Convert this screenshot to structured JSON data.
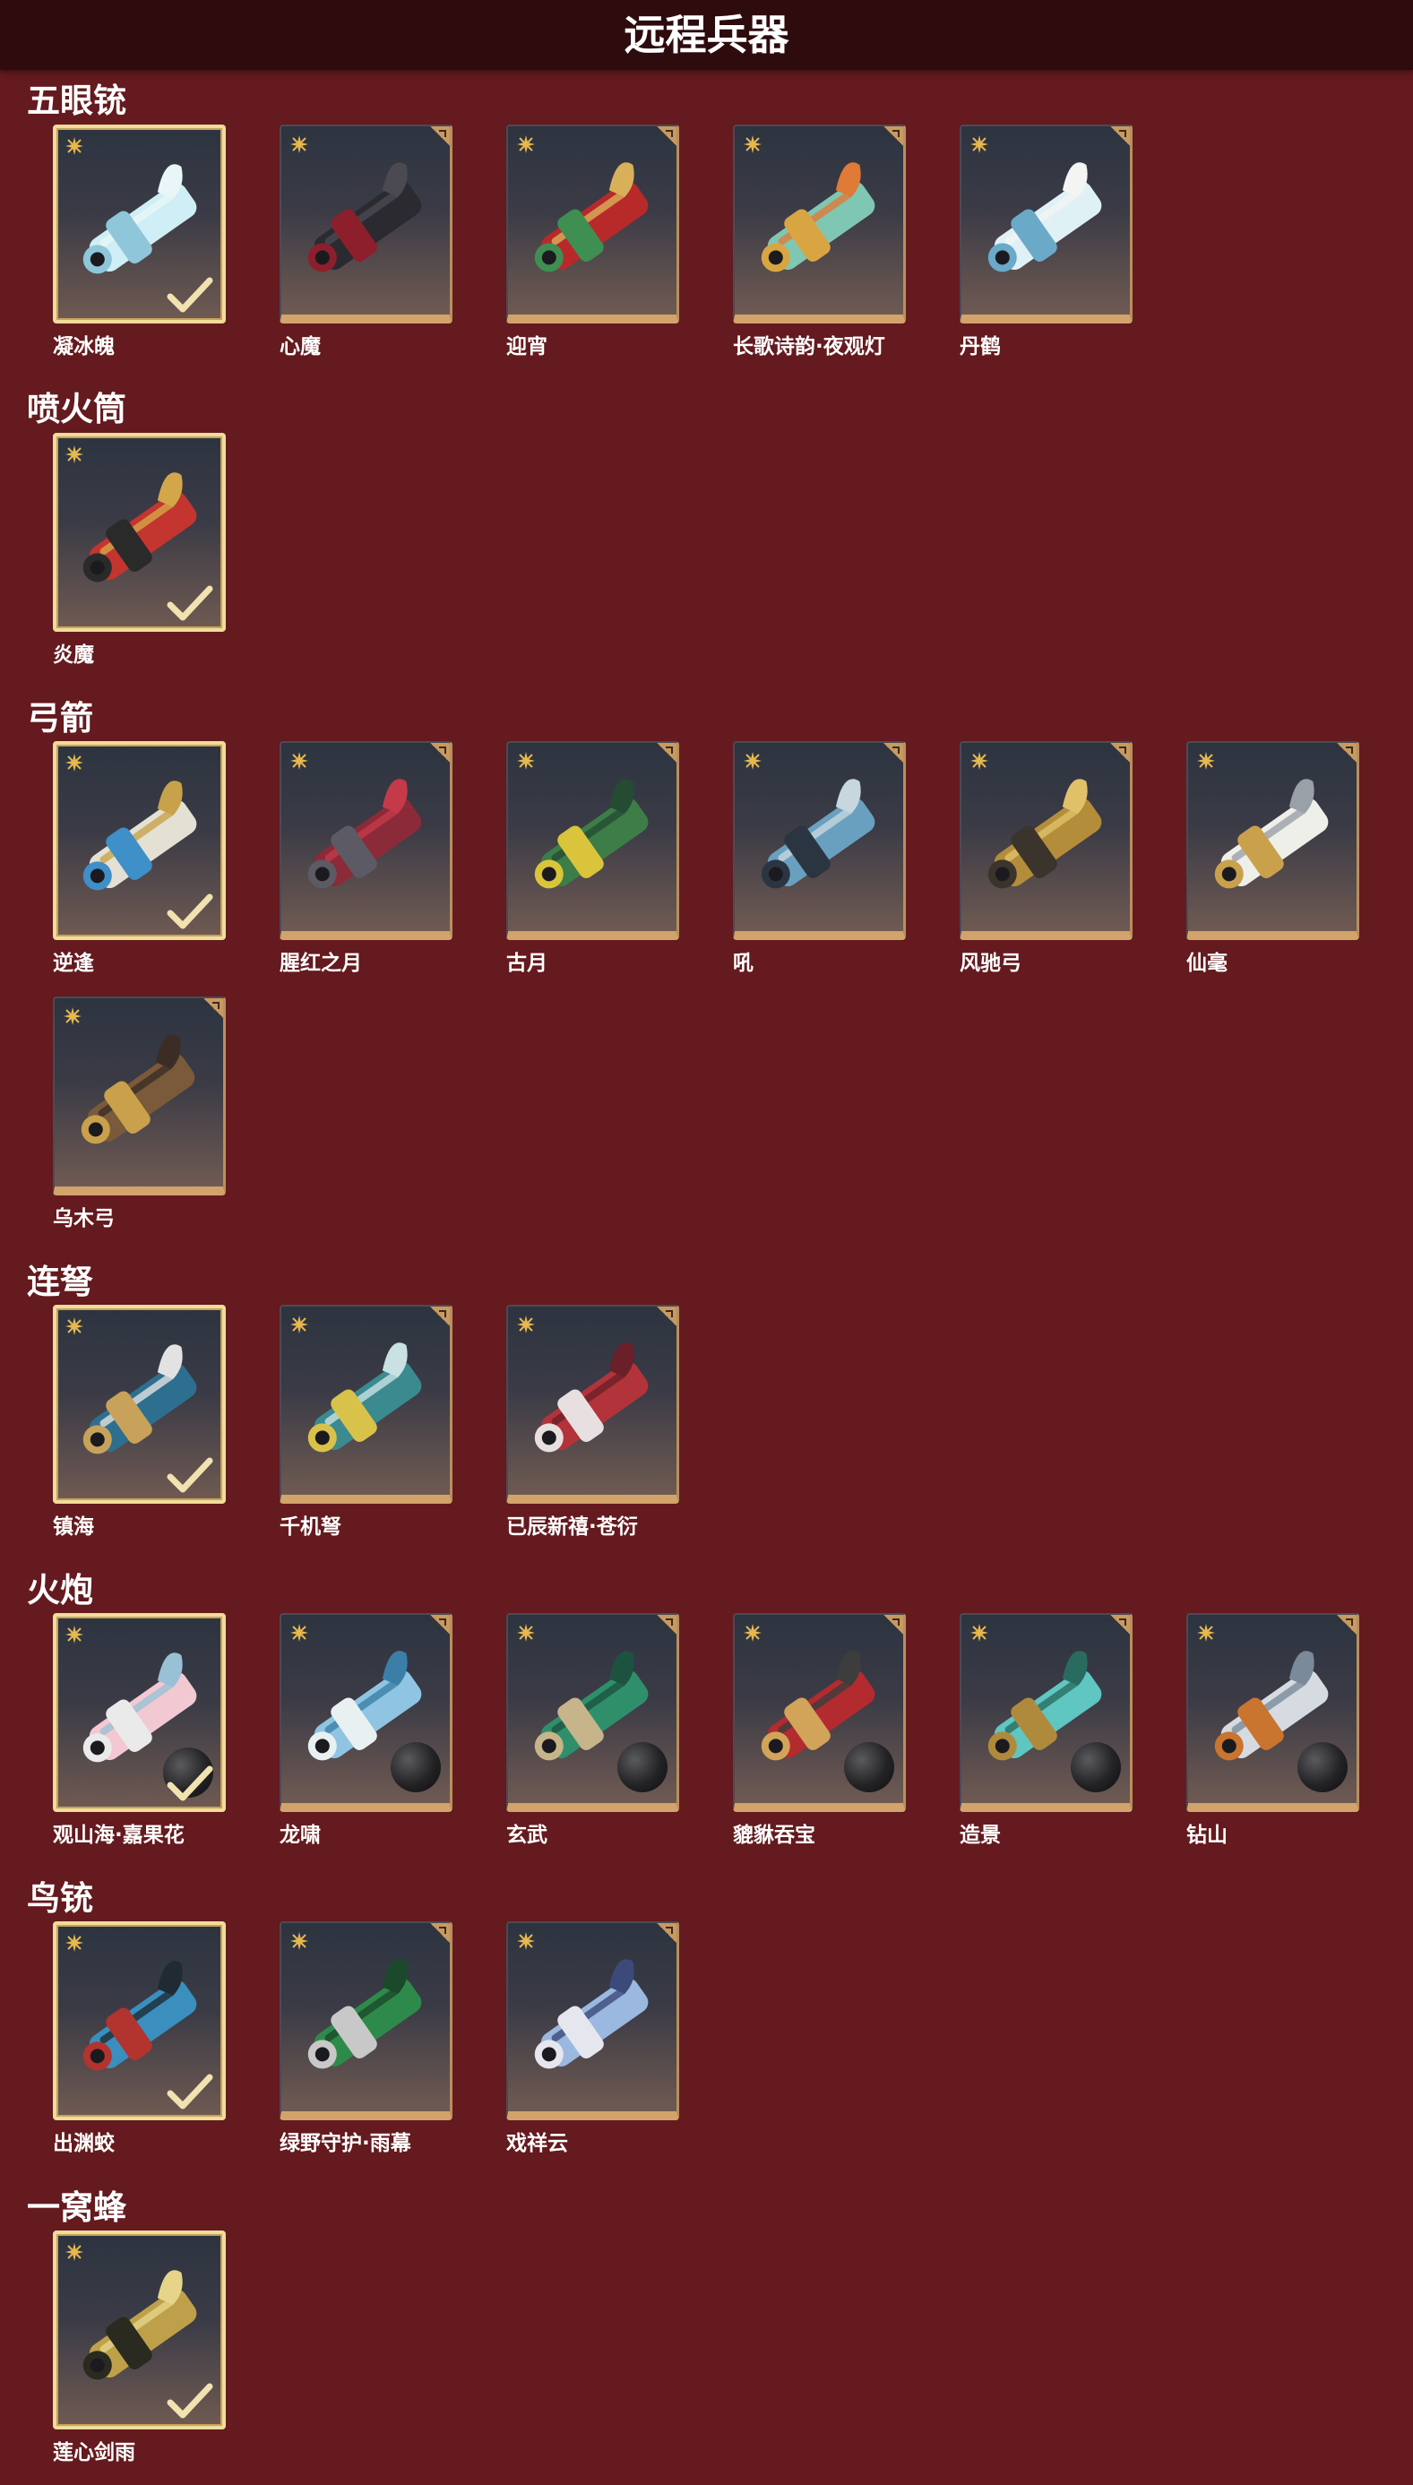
{
  "header": {
    "title": "远程兵器"
  },
  "colors": {
    "background": "#641a1e",
    "header_bar": "#2e0c0e",
    "card_border_gold": "#d2a36a",
    "selected_border": "#f1dc9a",
    "rarity_icon": "#e8b84d",
    "check": "#f2e2b0"
  },
  "sections": [
    {
      "title": "五眼铳",
      "items": [
        {
          "name": "凝冰魄",
          "selected": true,
          "art": "ice-cannon"
        },
        {
          "name": "心魔",
          "selected": false,
          "art": "demon-cannon"
        },
        {
          "name": "迎宵",
          "selected": false,
          "art": "red-cannon"
        },
        {
          "name": "长歌诗韵·夜观灯",
          "selected": false,
          "art": "jade-cannon"
        },
        {
          "name": "丹鹤",
          "selected": false,
          "art": "crane-cannon"
        }
      ]
    },
    {
      "title": "喷火筒",
      "items": [
        {
          "name": "炎魔",
          "selected": true,
          "art": "flame-tube"
        }
      ]
    },
    {
      "title": "弓箭",
      "items": [
        {
          "name": "逆逢",
          "selected": true,
          "art": "ornate-bow"
        },
        {
          "name": "腥红之月",
          "selected": false,
          "art": "crimson-bow"
        },
        {
          "name": "古月",
          "selected": false,
          "art": "green-bow"
        },
        {
          "name": "吼",
          "selected": false,
          "art": "blue-bow"
        },
        {
          "name": "风驰弓",
          "selected": false,
          "art": "gold-bow"
        },
        {
          "name": "仙毫",
          "selected": false,
          "art": "white-bow"
        },
        {
          "name": "乌木弓",
          "selected": false,
          "art": "wood-bow"
        }
      ]
    },
    {
      "title": "连弩",
      "items": [
        {
          "name": "镇海",
          "selected": true,
          "art": "sea-crossbow"
        },
        {
          "name": "千机弩",
          "selected": false,
          "art": "teal-crossbow"
        },
        {
          "name": "已辰新禧·苍衍",
          "selected": false,
          "art": "red-crossbow"
        }
      ]
    },
    {
      "title": "火炮",
      "items": [
        {
          "name": "观山海·嘉果花",
          "selected": true,
          "art": "flower-cannon"
        },
        {
          "name": "龙啸",
          "selected": false,
          "art": "dragon-cannon"
        },
        {
          "name": "玄武",
          "selected": false,
          "art": "turtle-cannon"
        },
        {
          "name": "貔貅吞宝",
          "selected": false,
          "art": "pixiu-cannon"
        },
        {
          "name": "造景",
          "selected": false,
          "art": "teal-cannon"
        },
        {
          "name": "钻山",
          "selected": false,
          "art": "drill-cannon"
        }
      ]
    },
    {
      "title": "鸟铳",
      "items": [
        {
          "name": "出渊蛟",
          "selected": true,
          "art": "dragon-musket"
        },
        {
          "name": "绿野守护·雨幕",
          "selected": false,
          "art": "green-musket"
        },
        {
          "name": "戏祥云",
          "selected": false,
          "art": "cloud-musket"
        }
      ]
    },
    {
      "title": "一窝蜂",
      "items": [
        {
          "name": "莲心剑雨",
          "selected": true,
          "art": "lotus-launcher"
        }
      ]
    }
  ]
}
